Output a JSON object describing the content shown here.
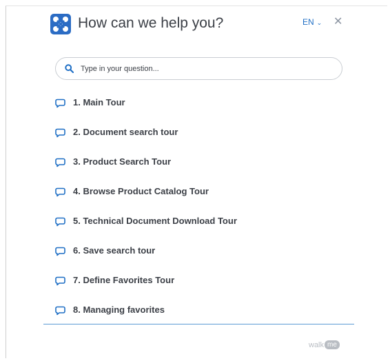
{
  "header": {
    "title": "How can we help you?",
    "language": "EN",
    "close_symbol": "✕"
  },
  "search": {
    "placeholder": "Type in your question..."
  },
  "icons": {
    "logo": "walkme-logo-icon",
    "search": "search-icon",
    "item": "chat-bubble-icon",
    "language_toggle": "chevron-down-icon",
    "close": "close-icon"
  },
  "colors": {
    "accent": "#1f6fc5",
    "text": "#3b3f46",
    "divider": "#5b9bd5"
  },
  "items": [
    {
      "label": "1. Main Tour"
    },
    {
      "label": "2. Document search tour"
    },
    {
      "label": "3. Product Search Tour"
    },
    {
      "label": "4. Browse Product Catalog Tour"
    },
    {
      "label": "5. Technical Document Download Tour"
    },
    {
      "label": "6. Save search tour"
    },
    {
      "label": "7. Define Favorites Tour"
    },
    {
      "label": "8. Managing favorites"
    }
  ],
  "footer": {
    "brand_text": "walk",
    "brand_badge": "me"
  }
}
